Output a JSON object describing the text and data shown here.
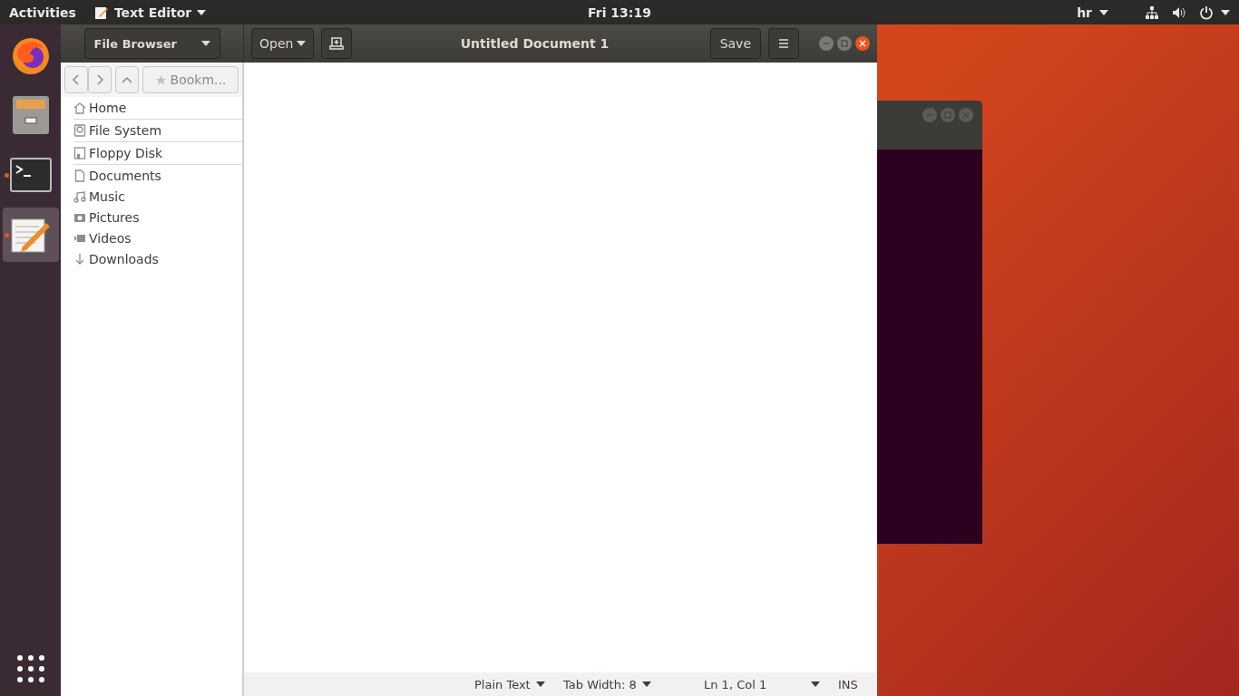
{
  "top_bar": {
    "activities": "Activities",
    "app_menu": "Text Editor",
    "clock": "Fri 13:19",
    "keyboard_layout": "hr"
  },
  "dock": {
    "apps": [
      {
        "kind": "browser",
        "running": false,
        "selected": false
      },
      {
        "kind": "files",
        "running": false,
        "selected": false
      },
      {
        "kind": "terminal",
        "running": true,
        "selected": false
      },
      {
        "kind": "editor",
        "running": true,
        "selected": true
      }
    ]
  },
  "editor_window": {
    "title": "Untitled Document 1",
    "side_panel_menu": "File Browser",
    "open_button": "Open",
    "save_button": "Save",
    "file_browser": {
      "bookmarks_button": "Bookm...",
      "devices": [
        {
          "kind": "home",
          "label": "Home"
        },
        {
          "kind": "drive",
          "label": "File System"
        },
        {
          "kind": "floppy",
          "label": "Floppy Disk"
        }
      ],
      "places": [
        {
          "kind": "document",
          "label": "Documents"
        },
        {
          "kind": "music",
          "label": "Music"
        },
        {
          "kind": "camera",
          "label": "Pictures"
        },
        {
          "kind": "video",
          "label": "Videos"
        },
        {
          "kind": "download",
          "label": "Downloads"
        }
      ]
    },
    "status_bar": {
      "language": "Plain Text",
      "tab_width": "Tab Width: 8",
      "position": "Ln 1, Col 1",
      "mode": "INS"
    }
  }
}
